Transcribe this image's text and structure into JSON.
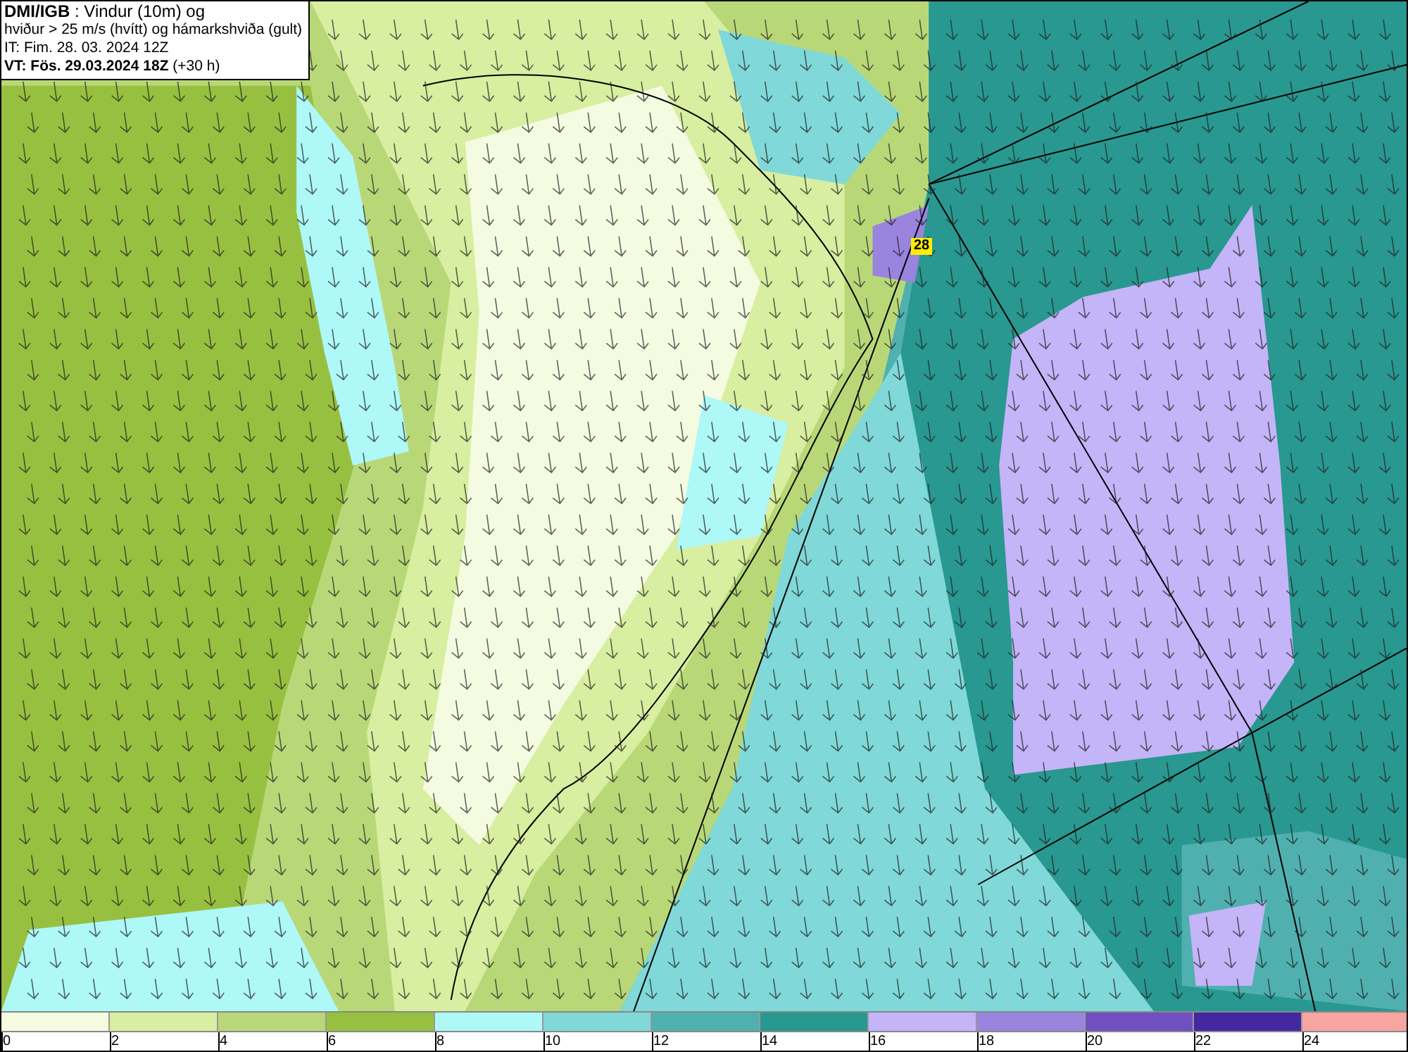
{
  "header": {
    "lines": [
      "**DMI/IGB** : Vindur (10m) og",
      "hviður > 25 m/s (hvítt) og hámarkshviða (gult)",
      "IT: Fim. 28. 03. 2024 12Z",
      "**VT: Fös. 29.03.2024 18Z** (+30 h)"
    ]
  },
  "map": {
    "max_gust_label": "28"
  },
  "legend": {
    "bins": [
      {
        "color": "#f5fbe0"
      },
      {
        "color": "#d8eea0"
      },
      {
        "color": "#b8d878"
      },
      {
        "color": "#98c040"
      },
      {
        "color": "#aef8f8"
      },
      {
        "color": "#80d8d8"
      },
      {
        "color": "#50b0b0"
      },
      {
        "color": "#289890"
      },
      {
        "color": "#c4b4f8"
      },
      {
        "color": "#9a84de"
      },
      {
        "color": "#7050c0"
      },
      {
        "color": "#4428a0"
      },
      {
        "color": "#f8a4a0"
      }
    ],
    "ticks": [
      "0",
      "2",
      "4",
      "6",
      "8",
      "10",
      "12",
      "14",
      "16",
      "18",
      "20",
      "22",
      "24"
    ]
  }
}
